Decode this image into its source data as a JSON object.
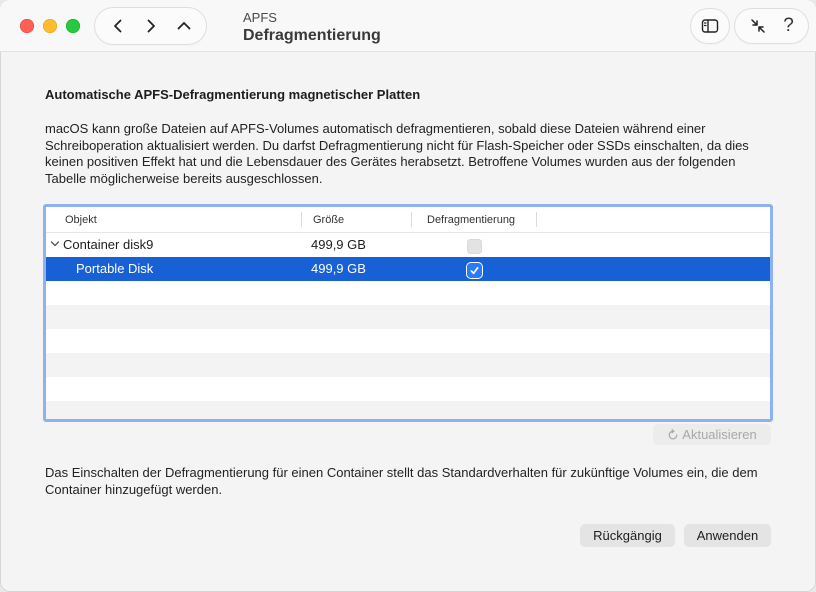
{
  "window": {
    "title_small": "APFS",
    "title_main": "Defragmentierung"
  },
  "nav": {
    "back_icon": "chevron-left-icon",
    "forward_icon": "chevron-right-icon",
    "up_icon": "chevron-up-icon"
  },
  "toolbar": {
    "sidebar_icon": "sidebar-icon",
    "collapse_icon": "arrows-collapse-icon",
    "help_label": "?"
  },
  "main": {
    "heading": "Automatische APFS-Defragmentierung magnetischer Platten",
    "description": "macOS kann große Dateien auf APFS-Volumes automatisch defragmentieren, sobald diese Dateien während einer Schreiboperation aktualisiert werden. Du darfst Defragmentierung nicht für Flash-Speicher oder SSDs einschalten, da dies keinen positiven Effekt hat und die Lebensdauer des Gerätes herabsetzt. Betroffene Volumes wurden aus der folgenden Tabelle möglicherweise bereits ausgeschlossen.",
    "table": {
      "columns": [
        "Objekt",
        "Größe",
        "Defragmentierung"
      ],
      "rows": [
        {
          "name": "Container disk9",
          "size": "499,9 GB",
          "defrag": false,
          "expanded": true,
          "selected": false
        },
        {
          "name": "Portable Disk",
          "size": "499,9 GB",
          "defrag": true,
          "expanded": false,
          "selected": true
        }
      ]
    },
    "refresh_label": "Aktualisieren",
    "footer_note": "Das Einschalten der Defragmentierung für einen Container stellt das Standardverhalten für zukünftige Volumes ein, die dem Container hinzugefügt werden.",
    "undo_label": "Rückgängig",
    "apply_label": "Anwenden"
  },
  "colors": {
    "selection": "#1860d6",
    "checkbox_on": "#2a7bf6",
    "focus_ring": "#8db2ef",
    "close": "#fe5f57",
    "minimize": "#febc2e",
    "maximize": "#28c840"
  }
}
